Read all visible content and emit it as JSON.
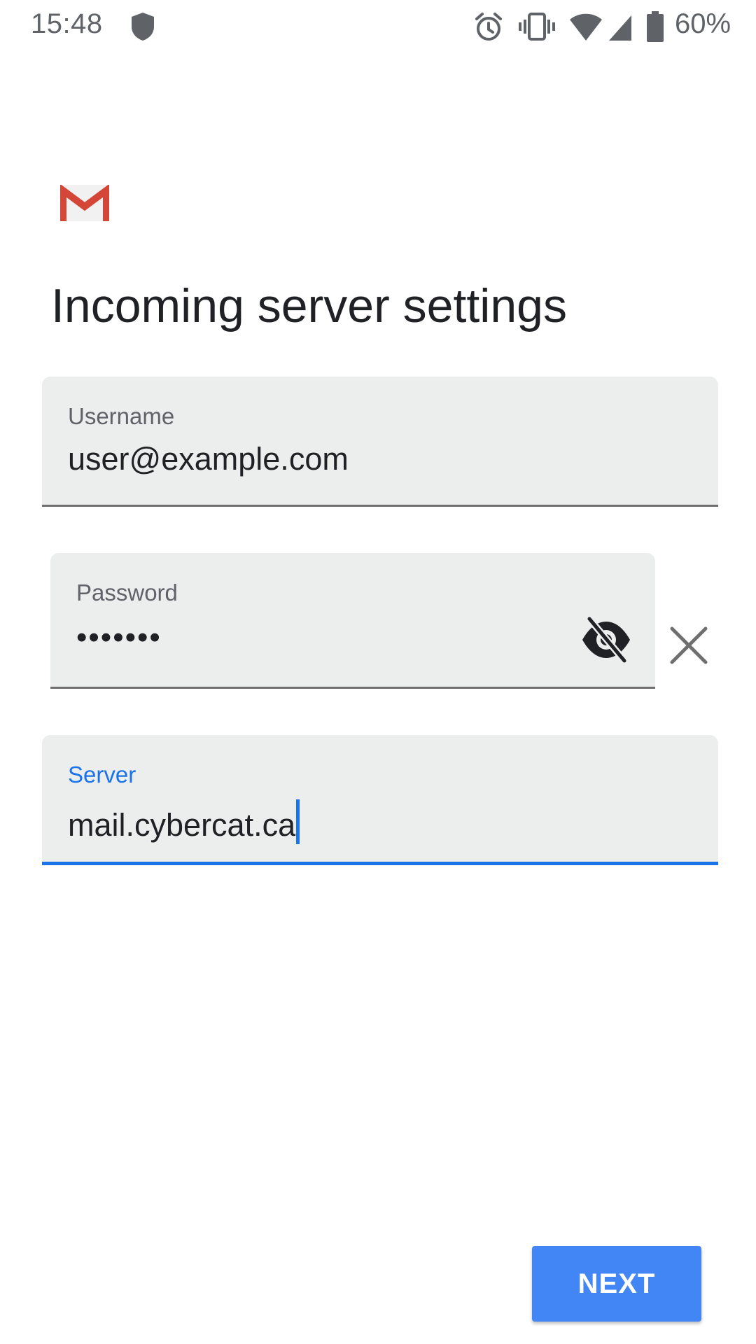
{
  "status_bar": {
    "time": "15:48",
    "battery_percent": "60%",
    "icons": [
      "shield-icon",
      "alarm-icon",
      "vibrate-icon",
      "wifi-icon",
      "signal-icon",
      "battery-icon"
    ]
  },
  "app": {
    "logo": "gmail-logo"
  },
  "page": {
    "title": "Incoming server settings"
  },
  "form": {
    "username": {
      "label": "Username",
      "value": "user@example.com"
    },
    "password": {
      "label": "Password",
      "value": "•••••••",
      "toggle_icon": "visibility-off-icon",
      "clear_icon": "close-icon"
    },
    "server": {
      "label": "Server",
      "value": "mail.cybercat.ca",
      "focused": true
    }
  },
  "actions": {
    "next_label": "NEXT"
  },
  "colors": {
    "accent": "#1a73e8",
    "button": "#4285f4",
    "field_bg": "#eceeee",
    "gmail_red": "#d44638"
  }
}
